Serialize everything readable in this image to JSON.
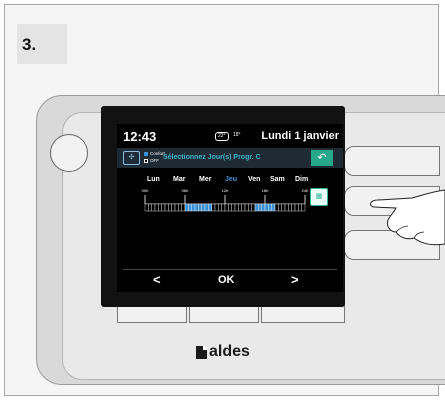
{
  "step": {
    "label": "3."
  },
  "brand": {
    "name": "aldes"
  },
  "screen": {
    "time": "12:43",
    "temperature_badge": "22°",
    "outdoor_temp": "18°",
    "date": "Lundi 1 janvier",
    "legend": [
      {
        "label": "Confort",
        "color": "#3a8fd6"
      },
      {
        "label": "OFF",
        "color": "#000000"
      }
    ],
    "instruction": "Sélectionnez Jour(s) Progr. C",
    "days": [
      {
        "label": "Lun",
        "selected": false
      },
      {
        "label": "Mar",
        "selected": false
      },
      {
        "label": "Mer",
        "selected": false
      },
      {
        "label": "Jeu",
        "selected": true
      },
      {
        "label": "Ven",
        "selected": false
      },
      {
        "label": "Sam",
        "selected": false
      },
      {
        "label": "Dim",
        "selected": false
      }
    ],
    "hour_ticks": [
      "00h",
      "06h",
      "12h",
      "18h",
      "24h"
    ],
    "schedule_slots": [
      0,
      0,
      0,
      0,
      0,
      0,
      0,
      0,
      0,
      0,
      0,
      0,
      1,
      1,
      1,
      1,
      1,
      1,
      1,
      1,
      0,
      0,
      0,
      0,
      0,
      0,
      0,
      0,
      0,
      0,
      0,
      0,
      0,
      1,
      1,
      1,
      1,
      1,
      1,
      0,
      0,
      0,
      0,
      0,
      0,
      0,
      0,
      0
    ],
    "nav": {
      "prev": "<",
      "ok": "OK",
      "next": ">"
    },
    "colors": {
      "accent": "#3ab7c9",
      "back_button": "#27a88a",
      "comfort_slot": "#3a8fd6",
      "selected_day": "#3a8fd6"
    }
  },
  "icons": {
    "mode": "ventilation-mode-icon",
    "back": "return-arrow-icon",
    "calendar": "calendar-copy-icon",
    "thermometer": "thermometer-icon",
    "hand": "pointing-hand-icon"
  }
}
